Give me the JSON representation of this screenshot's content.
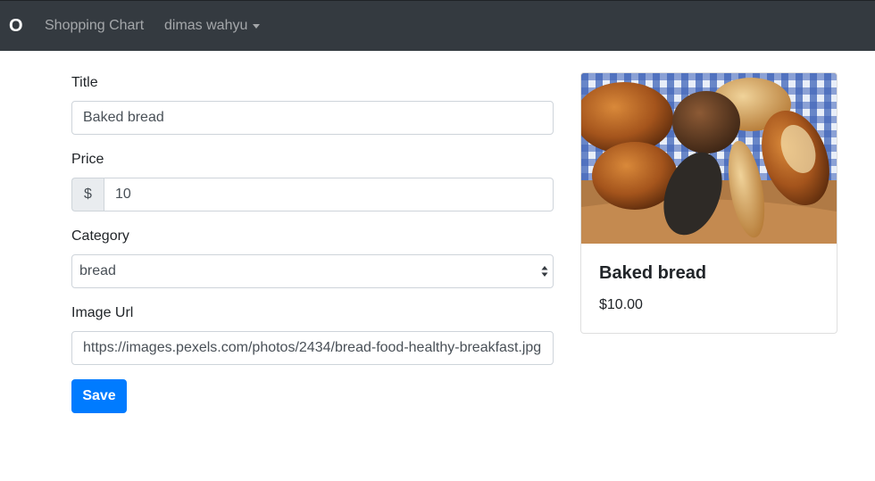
{
  "navbar": {
    "brand": "O",
    "links": [
      {
        "label": "Shopping Chart"
      },
      {
        "label": "dimas wahyu"
      }
    ]
  },
  "form": {
    "title": {
      "label": "Title",
      "value": "Baked bread"
    },
    "price": {
      "label": "Price",
      "currency": "$",
      "value": "10"
    },
    "category": {
      "label": "Category",
      "value": "bread"
    },
    "image_url": {
      "label": "Image Url",
      "value": "https://images.pexels.com/photos/2434/bread-food-healthy-breakfast.jpg"
    },
    "save_label": "Save"
  },
  "card": {
    "title": "Baked bread",
    "price": "$10.00"
  },
  "colors": {
    "navbar_bg": "#343a40",
    "primary": "#007bff"
  }
}
